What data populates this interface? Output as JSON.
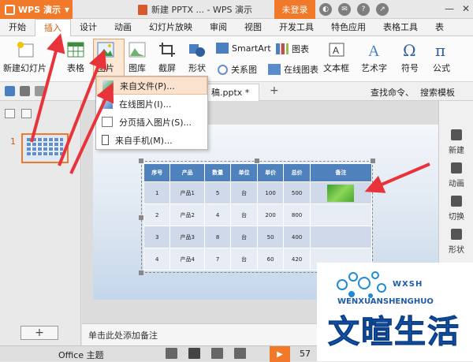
{
  "titlebar": {
    "app_label": "WPS 演示",
    "doc_title": "新建 PPTX ... - WPS 演示",
    "login_label": "未登录",
    "icons": [
      "skin-icon",
      "mail-icon",
      "help-icon",
      "share-icon"
    ]
  },
  "menu": {
    "tabs": [
      "开始",
      "插入",
      "设计",
      "动画",
      "幻灯片放映",
      "审阅",
      "视图",
      "开发工具",
      "特色应用",
      "表格工具",
      "表"
    ],
    "active": "插入"
  },
  "ribbon": {
    "new_slide": "新建幻灯片",
    "table": "表格",
    "picture": "图片",
    "gallery": "图库",
    "screenshot": "截屏",
    "shape": "形状",
    "relation": "关系图",
    "smartart": "SmartArt",
    "chart": "图表",
    "online_chart": "在线图表",
    "textbox": "文本框",
    "wordart": "艺术字",
    "symbol": "符号",
    "formula": "公式"
  },
  "dropdown": {
    "items": [
      "来自文件(P)...",
      "在线图片(I)...",
      "分页插入图片(S)...",
      "来自手机(M)..."
    ]
  },
  "doc_tab": {
    "label": "稿.pptx *",
    "search_cmd": "查找命令、",
    "search_template": "搜索模板"
  },
  "slide_panel": {
    "slide_number": "1",
    "add_slide": "+"
  },
  "table": {
    "headers": [
      "序号",
      "产品",
      "数量",
      "单位",
      "单价",
      "总价",
      "备注"
    ],
    "rows": [
      [
        "1",
        "产品1",
        "5",
        "台",
        "100",
        "500",
        ""
      ],
      [
        "2",
        "产品2",
        "4",
        "台",
        "200",
        "800",
        ""
      ],
      [
        "3",
        "产品3",
        "8",
        "台",
        "50",
        "400",
        ""
      ],
      [
        "4",
        "产品4",
        "7",
        "台",
        "60",
        "420",
        ""
      ]
    ]
  },
  "notes": "单击此处添加备注",
  "right_pane": [
    "新建",
    "动画",
    "切换",
    "形状"
  ],
  "status": {
    "theme": "Office 主题",
    "zoom": "57"
  },
  "watermark": {
    "top": "WXSH",
    "pinyin": "WENXUANSHENGHUO",
    "cn": "文暄生活"
  },
  "colors": {
    "accent": "#f07a2a",
    "table_header": "#4f81bd",
    "arrow": "#e8333a"
  }
}
